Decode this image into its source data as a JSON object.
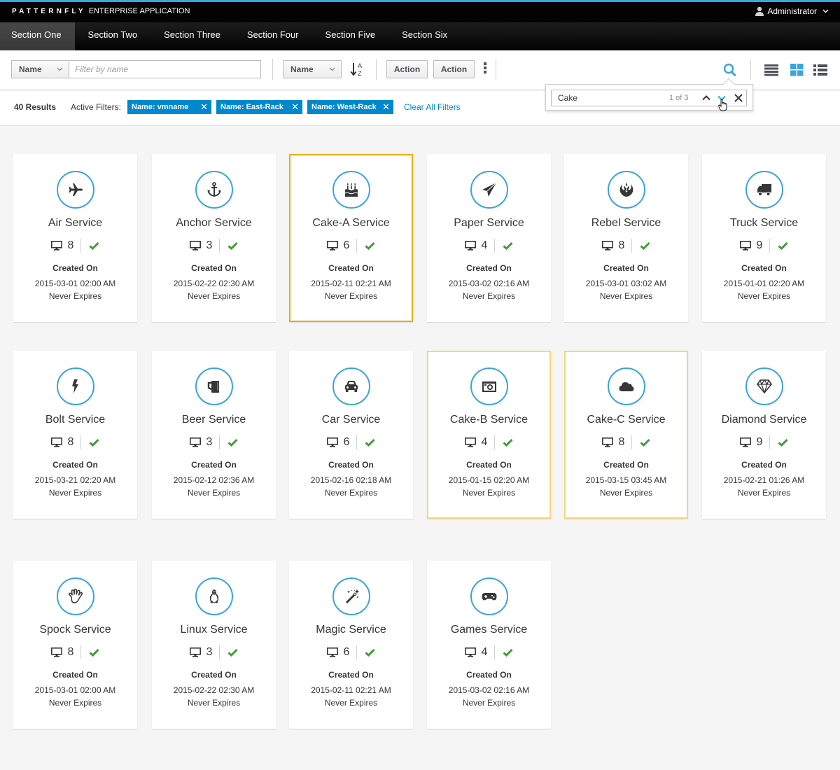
{
  "masthead": {
    "brand_logo": "PATTERNFLY",
    "brand_app": "ENTERPRISE APPLICATION",
    "user_name": "Administrator"
  },
  "nav": {
    "items": [
      {
        "label": "Section One",
        "active": true
      },
      {
        "label": "Section Two",
        "active": false
      },
      {
        "label": "Section Three",
        "active": false
      },
      {
        "label": "Section Four",
        "active": false
      },
      {
        "label": "Section Five",
        "active": false
      },
      {
        "label": "Section Six",
        "active": false
      }
    ]
  },
  "toolbar": {
    "filter_field": "Name",
    "filter_placeholder": "Filter by name",
    "sort_field": "Name",
    "sort_icon": "sort-alpha-asc-icon",
    "actions": [
      "Action",
      "Action"
    ],
    "kebab_icon": "kebab-icon",
    "search_icon": "search-icon",
    "views": [
      {
        "name": "list-view",
        "active": false
      },
      {
        "name": "card-view",
        "active": true
      },
      {
        "name": "table-view",
        "active": false
      }
    ]
  },
  "results": {
    "count_label": "40 Results",
    "active_filters_label": "Active Filters:",
    "filters": [
      "Name: vmname",
      "Name: East-Rack",
      "Name: West-Rack"
    ],
    "clear_label": "Clear All Filters"
  },
  "find": {
    "value": "Cake",
    "match_label": "1 of 3"
  },
  "colors": {
    "accent": "#39a5dc",
    "chip": "#0088ce",
    "highlight_current": "#f0ab00",
    "highlight_match": "#f9d67a",
    "ok": "#3f9c35"
  },
  "cards": [
    {
      "title": "Air Service",
      "icon": "plane-icon",
      "vms": "8",
      "status": "ok",
      "created_label": "Created On",
      "created": "2015-03-01 02:00 AM",
      "expires": "Never Expires",
      "highlight": "none"
    },
    {
      "title": "Anchor Service",
      "icon": "anchor-icon",
      "vms": "3",
      "status": "ok",
      "created_label": "Created On",
      "created": "2015-02-22 02:30 AM",
      "expires": "Never Expires",
      "highlight": "none"
    },
    {
      "title": "Cake-A Service",
      "icon": "birthday-cake-icon",
      "vms": "6",
      "status": "ok",
      "created_label": "Created On",
      "created": "2015-02-11 02:21 AM",
      "expires": "Never Expires",
      "highlight": "current"
    },
    {
      "title": "Paper Service",
      "icon": "paper-plane-icon",
      "vms": "4",
      "status": "ok",
      "created_label": "Created On",
      "created": "2015-03-02 02:16 AM",
      "expires": "Never Expires",
      "highlight": "none"
    },
    {
      "title": "Rebel Service",
      "icon": "rebel-icon",
      "vms": "8",
      "status": "ok",
      "created_label": "Created On",
      "created": "2015-03-01 03:02 AM",
      "expires": "Never Expires",
      "highlight": "none"
    },
    {
      "title": "Truck Service",
      "icon": "truck-icon",
      "vms": "9",
      "status": "ok",
      "created_label": "Created On",
      "created": "2015-01-01 02:20 AM",
      "expires": "Never Expires",
      "highlight": "none"
    },
    {
      "title": "Bolt Service",
      "icon": "bolt-icon",
      "vms": "8",
      "status": "ok",
      "created_label": "Created On",
      "created": "2015-03-21 02:20 AM",
      "expires": "Never Expires",
      "highlight": "none"
    },
    {
      "title": "Beer Service",
      "icon": "beer-icon",
      "vms": "3",
      "status": "ok",
      "created_label": "Created On",
      "created": "2015-02-12 02:36 AM",
      "expires": "Never Expires",
      "highlight": "none"
    },
    {
      "title": "Car Service",
      "icon": "car-icon",
      "vms": "6",
      "status": "ok",
      "created_label": "Created On",
      "created": "2015-02-16 02:18 AM",
      "expires": "Never Expires",
      "highlight": "none"
    },
    {
      "title": "Cake-B Service",
      "icon": "camera-icon",
      "vms": "4",
      "status": "ok",
      "created_label": "Created On",
      "created": "2015-01-15 02:20 AM",
      "expires": "Never Expires",
      "highlight": "match"
    },
    {
      "title": "Cake-C Service",
      "icon": "cloud-icon",
      "vms": "8",
      "status": "ok",
      "created_label": "Created On",
      "created": "2015-03-15 03:45 AM",
      "expires": "Never Expires",
      "highlight": "match"
    },
    {
      "title": "Diamond Service",
      "icon": "diamond-icon",
      "vms": "9",
      "status": "ok",
      "created_label": "Created On",
      "created": "2015-02-21 01:26 AM",
      "expires": "Never Expires",
      "highlight": "none"
    },
    {
      "title": "Spock Service",
      "icon": "hand-spock-icon",
      "vms": "8",
      "status": "ok",
      "created_label": "Created On",
      "created": "2015-03-01 02:00 AM",
      "expires": "Never Expires",
      "highlight": "none"
    },
    {
      "title": "Linux Service",
      "icon": "linux-icon",
      "vms": "3",
      "status": "ok",
      "created_label": "Created On",
      "created": "2015-02-22 02:30 AM",
      "expires": "Never Expires",
      "highlight": "none"
    },
    {
      "title": "Magic Service",
      "icon": "magic-wand-icon",
      "vms": "6",
      "status": "ok",
      "created_label": "Created On",
      "created": "2015-02-11 02:21 AM",
      "expires": "Never Expires",
      "highlight": "none"
    },
    {
      "title": "Games Service",
      "icon": "gamepad-icon",
      "vms": "4",
      "status": "ok",
      "created_label": "Created On",
      "created": "2015-03-02 02:16 AM",
      "expires": "Never Expires",
      "highlight": "none"
    }
  ]
}
